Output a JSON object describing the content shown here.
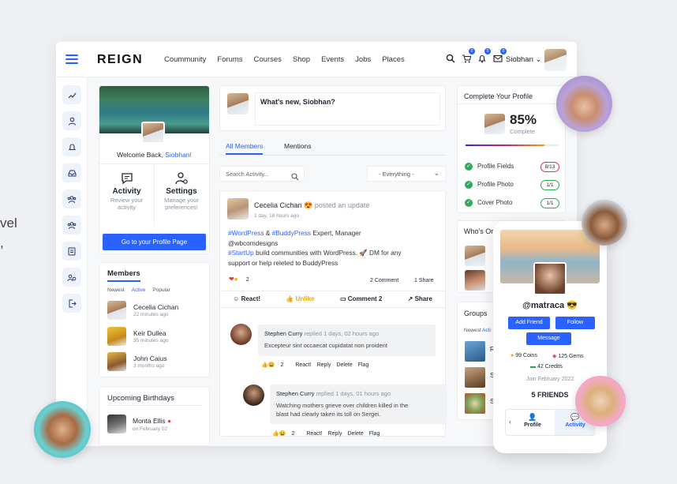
{
  "background": {
    "fragment1": "vel",
    "fragment2": ","
  },
  "brand": {
    "logo": "REIGN",
    "accent": "#2962ff"
  },
  "nav": [
    "Coummunity",
    "Forums",
    "Courses",
    "Shop",
    "Events",
    "Jobs",
    "Places"
  ],
  "topbar": {
    "user_name": "Siobhan",
    "badges": [
      "0",
      "0",
      "0"
    ]
  },
  "sidebar_icons": [
    "chart-icon",
    "user-icon",
    "bell-icon",
    "inbox-icon",
    "group-icon",
    "members-icon",
    "document-icon",
    "settings-group-icon",
    "logout-icon"
  ],
  "profile_card": {
    "welcome": "Welcome Back,",
    "name": "Siobhan!",
    "activity_title": "Activity",
    "activity_desc": "Review your activity",
    "settings_title": "Settings",
    "settings_desc": "Manage your preferences!",
    "profile_button": "Go to your Profile Page"
  },
  "members_widget": {
    "title": "Members",
    "tabs": [
      "Newest",
      "Active",
      "Popular"
    ],
    "items": [
      {
        "name": "Cecelia Cichan",
        "time": "22 minutes ago"
      },
      {
        "name": "Keir Dullea",
        "time": "35 minutes ago"
      },
      {
        "name": "John Caius",
        "time": "3 months ago"
      }
    ]
  },
  "birthdays": {
    "title": "Upcoming Birthdays",
    "name": "Monta Ellis",
    "date": "on February 02"
  },
  "composer": {
    "placeholder": "What's new, Siobhan?"
  },
  "feed_tabs": [
    "All Members",
    "Mentions"
  ],
  "search": {
    "placeholder": "Search Activity...",
    "filter": "- Everything -"
  },
  "post": {
    "author": "Cecelia Cichan",
    "emoji": "😍",
    "action": "posted an update",
    "time": "1 day, 18 hours ago",
    "line1_tag1": "#WordPress",
    "line1_amp": " & ",
    "line1_tag2": "#BuddyPress",
    "line1_rest": " Expert, Manager",
    "line2": "@wbcomdesigns",
    "line3_tag": "#StartUp",
    "line3_rest": " build communities with WordPress. 🚀 DM for any",
    "line4": "support or help releted to BuddyPress",
    "reactions_count": "2",
    "comments": "2 Comment",
    "shares": "1 Share",
    "react_label": "React!",
    "unlike_label": "Unlike",
    "comment_label": "Comment 2",
    "share_label": "Share"
  },
  "comments": [
    {
      "author": "Stephen Curry",
      "action": "replied",
      "time": "1 days, 02 hours ago",
      "text": "Excepteur sint occaecat cupidatat non proident",
      "count": "2"
    },
    {
      "author": "Stephen Curry",
      "action": "replied",
      "time": "1 days, 01 hours ago",
      "text1": "Watching mothers grieve over children killed in the",
      "text2": "blast had clearly taken its toll on Sergei.",
      "count": "2"
    }
  ],
  "comment_actions": [
    "React!",
    "Reply",
    "Delete",
    "Flag"
  ],
  "complete_profile": {
    "title": "Complete Your Profile",
    "percent": "85%",
    "label": "Complete",
    "progress": 0.85,
    "rows": [
      {
        "label": "Profile Fields",
        "value": "8/13",
        "status": "incomplete"
      },
      {
        "label": "Profile Photo",
        "value": "1/1",
        "status": "complete"
      },
      {
        "label": "Cover Photo",
        "value": "1/1",
        "status": "complete"
      }
    ]
  },
  "whos_online": {
    "title": "Who's Or"
  },
  "groups": {
    "title": "Groups",
    "tabs": [
      "Newest",
      "Acti"
    ],
    "letters": [
      "R",
      "S",
      "S"
    ]
  },
  "mobile": {
    "handle": "@matraca",
    "emoji": "😎",
    "add_friend": "Add Friend",
    "follow": "Follow",
    "message": "Message",
    "coins": "99 Coins",
    "gems": "125 Gems",
    "credits": "42 Credits",
    "joined": "Join February 2022",
    "friends": "5 FRIENDS",
    "tab_profile": "Profile",
    "tab_activity": "Activity"
  }
}
